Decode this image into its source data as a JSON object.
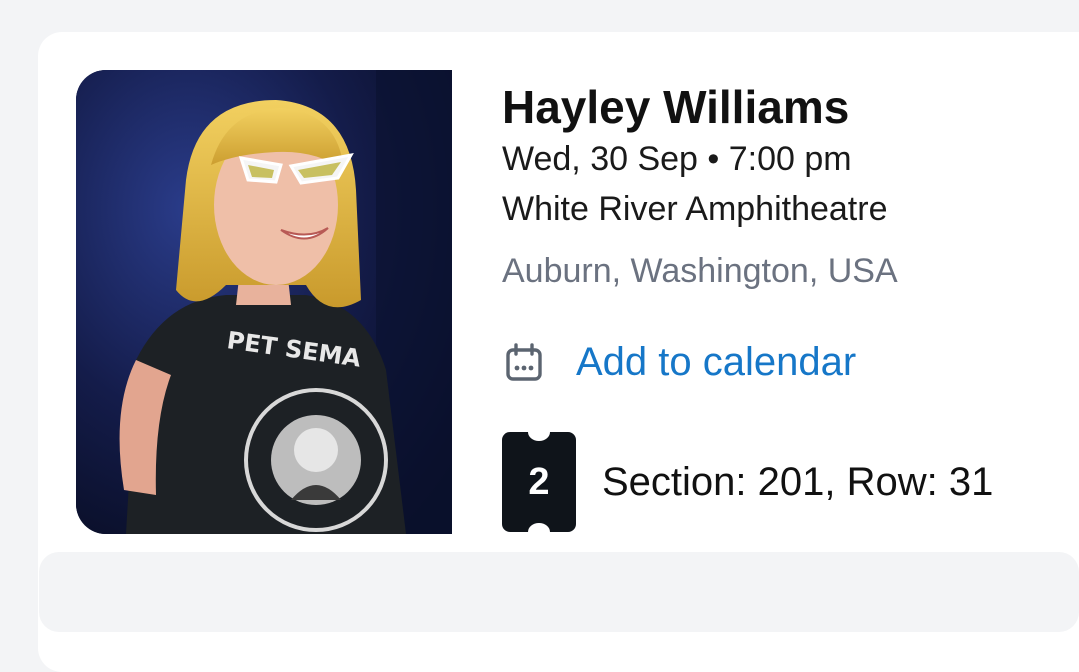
{
  "event": {
    "artist": "Hayley Williams",
    "datetime": "Wed, 30 Sep • 7:00 pm",
    "venue": "White River Amphitheatre",
    "location": "Auburn, Washington, USA",
    "image_alt": "Hayley Williams performing on stage"
  },
  "actions": {
    "add_to_calendar": "Add to calendar",
    "calendar_icon": "calendar-icon"
  },
  "tickets": {
    "count": "2",
    "seat_info": "Section: 201, Row: 31",
    "ticket_icon": "ticket-icon"
  },
  "colors": {
    "link": "#1677c8",
    "ticket_badge": "#0f141a",
    "muted_text": "#6b7280"
  }
}
